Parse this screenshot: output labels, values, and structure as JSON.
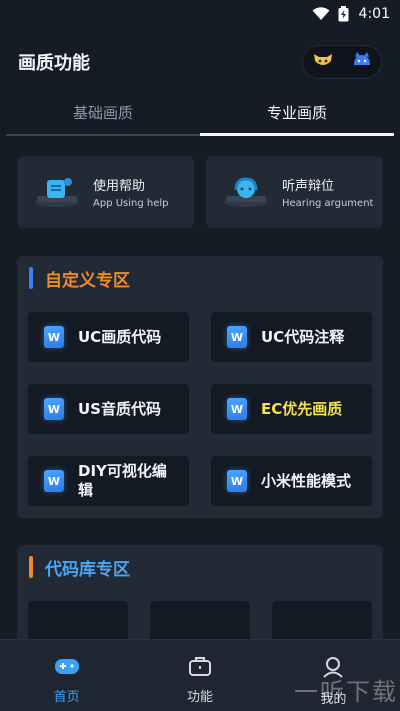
{
  "status_bar": {
    "time": "4:01"
  },
  "header": {
    "title": "画质功能"
  },
  "tabs": [
    {
      "label": "基础画质",
      "active": false
    },
    {
      "label": "专业画质",
      "active": true
    }
  ],
  "help_cards": [
    {
      "title": "使用帮助",
      "subtitle": "App Using help",
      "icon": "monitor-icon"
    },
    {
      "title": "听声辩位",
      "subtitle": "Hearing argument",
      "icon": "headset-icon"
    }
  ],
  "custom_section": {
    "title": "自定义专区",
    "items": [
      {
        "label": "UC画质代码"
      },
      {
        "label": "UC代码注释"
      },
      {
        "label": "US音质代码"
      },
      {
        "label": "EC优先画质"
      },
      {
        "label": "DIY可视化编辑"
      },
      {
        "label": "小米性能模式"
      }
    ]
  },
  "library_section": {
    "title": "代码库专区"
  },
  "bottom_nav": [
    {
      "label": "首页",
      "icon": "gamepad-icon",
      "active": true
    },
    {
      "label": "功能",
      "icon": "briefcase-icon",
      "active": false
    },
    {
      "label": "我的",
      "icon": "user-icon",
      "active": false
    }
  ],
  "watermark": "一听下载",
  "colors": {
    "background": "#161c26",
    "card": "#222a36",
    "accent_blue": "#39a2f6",
    "accent_orange": "#f08a2a",
    "highlight_yellow": "#f3e24a"
  }
}
